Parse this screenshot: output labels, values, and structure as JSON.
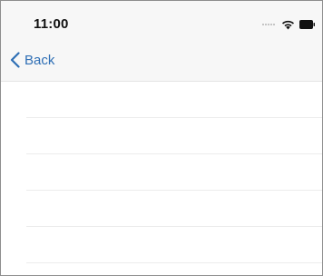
{
  "status_bar": {
    "time": "11:00",
    "icons": [
      "signal-dots-icon",
      "wifi-icon",
      "battery-icon"
    ]
  },
  "nav": {
    "back_label": "Back",
    "back_icon": "chevron-left-icon",
    "accent_color": "#2f6fb5"
  },
  "list": {
    "row_count": 5,
    "rows": [
      "",
      "",
      "",
      "",
      ""
    ]
  }
}
